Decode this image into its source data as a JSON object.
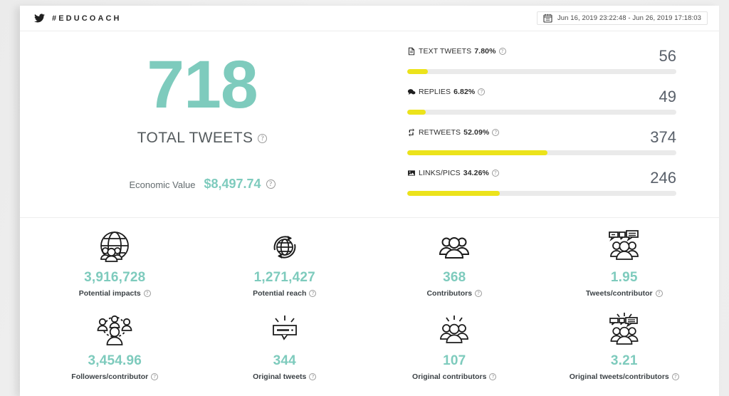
{
  "header": {
    "bird_icon": "twitter-bird-icon",
    "hashtag": "#EDUCOACH",
    "calendar_icon": "calendar-icon",
    "date_range": "Jun 16, 2019 23:22:48 - Jun 26, 2019 17:18:03"
  },
  "total": {
    "value": "718",
    "label": "TOTAL TWEETS",
    "help": "?",
    "economic_label": "Economic Value",
    "economic_value": "$8,497.74",
    "economic_help": "?"
  },
  "colors": {
    "teal": "#7ecbbd",
    "yellow": "#ece31b",
    "track": "#eaeaea",
    "value_gray": "#59606a"
  },
  "chart_data": {
    "type": "bar",
    "title": "Tweet type breakdown",
    "orientation": "horizontal",
    "categories": [
      "TEXT TWEETS",
      "REPLIES",
      "RETWEETS",
      "LINKS/PICS"
    ],
    "values": [
      56,
      49,
      374,
      246
    ],
    "percent_labels": [
      "7.80%",
      "6.82%",
      "52.09%",
      "34.26%"
    ],
    "percents": [
      7.8,
      6.82,
      52.09,
      34.26
    ],
    "xlim": [
      0,
      100
    ],
    "xlabel": "",
    "ylabel": "",
    "grid": false,
    "legend": false
  },
  "bars": [
    {
      "icon": "document-icon",
      "name": "TEXT TWEETS",
      "percent": "7.80%",
      "value": "56",
      "fill": 7.8,
      "help": "?"
    },
    {
      "icon": "reply-bubble-icon",
      "name": "REPLIES",
      "percent": "6.82%",
      "value": "49",
      "fill": 6.82,
      "help": "?"
    },
    {
      "icon": "retweet-icon",
      "name": "RETWEETS",
      "percent": "52.09%",
      "value": "374",
      "fill": 52.09,
      "help": "?"
    },
    {
      "icon": "image-icon",
      "name": "LINKS/PICS",
      "percent": "34.26%",
      "value": "246",
      "fill": 34.26,
      "help": "?"
    }
  ],
  "stats": [
    {
      "icon": "globe-people-icon",
      "value": "3,916,728",
      "label": "Potential impacts",
      "help": "?"
    },
    {
      "icon": "globe-refresh-icon",
      "value": "1,271,427",
      "label": "Potential reach",
      "help": "?"
    },
    {
      "icon": "people-group-icon",
      "value": "368",
      "label": "Contributors",
      "help": "?"
    },
    {
      "icon": "people-speech-icon",
      "value": "1.95",
      "label": "Tweets/contributor",
      "help": "?"
    },
    {
      "icon": "people-network-icon",
      "value": "3,454.96",
      "label": "Followers/contributor",
      "help": "?"
    },
    {
      "icon": "speech-sparkle-icon",
      "value": "344",
      "label": "Original tweets",
      "help": "?"
    },
    {
      "icon": "people-sparkle-icon",
      "value": "107",
      "label": "Original contributors",
      "help": "?"
    },
    {
      "icon": "people-speech-sparkle-icon",
      "value": "3.21",
      "label": "Original tweets/contributors",
      "help": "?"
    }
  ]
}
